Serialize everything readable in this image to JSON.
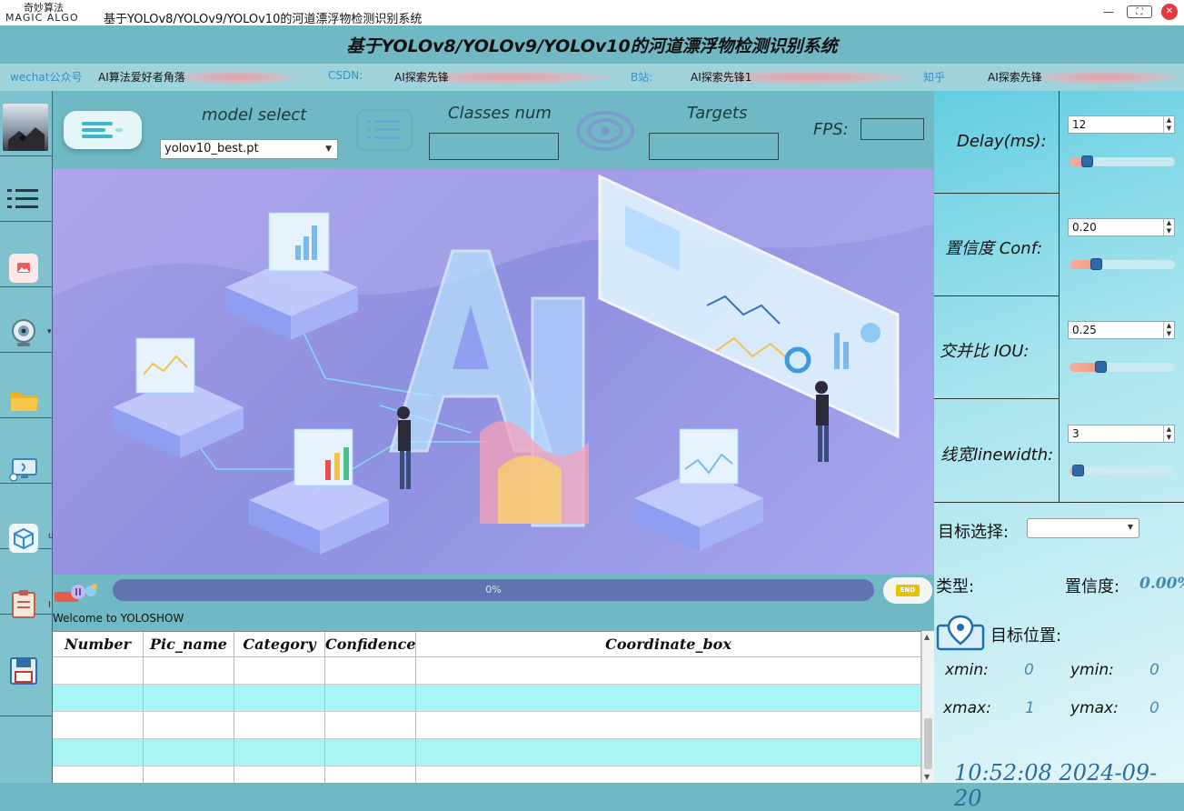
{
  "titlebar": {
    "logo_cn": "奇妙算法",
    "logo_en": "MAGIC ALGO",
    "window_title": "基于YOLOv8/YOLOv9/YOLOv10的河道漂浮物检测识别系统",
    "minimize": "—",
    "maximize": "⛶",
    "close": "✕"
  },
  "header": {
    "title": "基于YOLOv8/YOLOv9/YOLOv10的河道漂浮物检测识别系统"
  },
  "infobar": {
    "items": [
      {
        "label": "wechat公众号",
        "value": "AI算法爱好者角落"
      },
      {
        "label": "CSDN:",
        "value": "AI探索先锋"
      },
      {
        "label": "B站:",
        "value": "AI探索先锋1"
      },
      {
        "label": "知乎",
        "value": "AI探索先锋"
      }
    ]
  },
  "sidebar": {
    "items": [
      {
        "name": "avatar",
        "icon": "winter-photo-icon"
      },
      {
        "name": "menu",
        "icon": "list-menu-icon"
      },
      {
        "name": "image",
        "icon": "image-icon"
      },
      {
        "name": "camera",
        "icon": "webcam-icon"
      },
      {
        "name": "folder",
        "icon": "folder-icon"
      },
      {
        "name": "rtsp",
        "icon": "screen-cast-icon"
      },
      {
        "name": "model",
        "icon": "model-box-icon"
      },
      {
        "name": "results",
        "icon": "clipboard-icon"
      },
      {
        "name": "save",
        "icon": "save-icon"
      }
    ]
  },
  "controls": {
    "model_label": "model select",
    "model_value": "yolov10_best.pt",
    "classes_label": "Classes num",
    "classes_value": "",
    "targets_label": "Targets",
    "targets_value": "",
    "fps_label": "FPS:",
    "fps_value": ""
  },
  "progress": {
    "percent_text": "0%",
    "value": 0,
    "end_label": "END"
  },
  "status": {
    "message": "Welcome to YOLOSHOW"
  },
  "table": {
    "columns": [
      "Number",
      "Pic_name",
      "Category",
      "Confidence",
      "Coordinate_box"
    ],
    "rows": [
      [
        "",
        "",
        "",
        "",
        ""
      ],
      [
        "",
        "",
        "",
        "",
        ""
      ],
      [
        "",
        "",
        "",
        "",
        ""
      ],
      [
        "",
        "",
        "",
        "",
        ""
      ],
      [
        "",
        "",
        "",
        "",
        ""
      ]
    ]
  },
  "params": {
    "delay": {
      "label": "Delay(ms):",
      "value": "12",
      "level": 0.1
    },
    "conf": {
      "label": "置信度  Conf:",
      "value": "0.20",
      "level": 0.2
    },
    "iou": {
      "label": "交并比   IOU:",
      "value": "0.25",
      "level": 0.25
    },
    "linewidth": {
      "label": "线宽linewidth:",
      "value": "3",
      "level": 0.0
    }
  },
  "details": {
    "target_select_label": "目标选择:",
    "target_select_value": "",
    "type_label": "类型:",
    "conf_label": "置信度:",
    "conf_value": "0.00%",
    "position_label": "目标位置:",
    "xmin_label": "xmin:",
    "xmin_value": "0",
    "ymin_label": "ymin:",
    "ymin_value": "0",
    "xmax_label": "xmax:",
    "xmax_value": "1",
    "ymax_label": "ymax:",
    "ymax_value": "0",
    "clock": "10:52:08 2024-09-20"
  },
  "colors": {
    "background": "#6fb8c4",
    "accent": "#3cb6c8",
    "progress": "#5f74b0",
    "table_alt_row": "#aaf4f6"
  }
}
